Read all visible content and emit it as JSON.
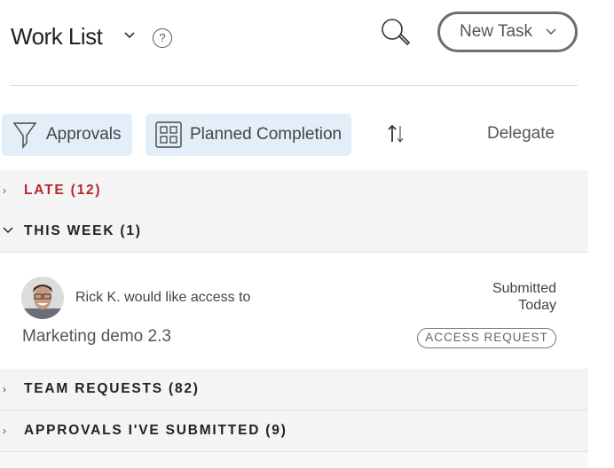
{
  "header": {
    "title": "Work List",
    "help_label": "?",
    "new_task_label": "New Task"
  },
  "toolbar": {
    "approvals_label": "Approvals",
    "planned_label": "Planned Completion",
    "delegate_label": "Delegate"
  },
  "sections": [
    {
      "label": "LATE (12)",
      "expanded": false,
      "color": "#b5272e"
    },
    {
      "label": "THIS WEEK (1)",
      "expanded": true
    },
    {
      "label": "TEAM REQUESTS (82)",
      "expanded": false
    },
    {
      "label": "APPROVALS I'VE SUBMITTED (9)",
      "expanded": false
    }
  ],
  "item": {
    "request_text": "Rick K. would like access to",
    "project": "Marketing demo 2.3",
    "status_line1": "Submitted",
    "status_line2": "Today",
    "badge": "ACCESS REQUEST"
  },
  "icons": {
    "chev_collapsed": "›",
    "chev_expanded": "⌄"
  }
}
